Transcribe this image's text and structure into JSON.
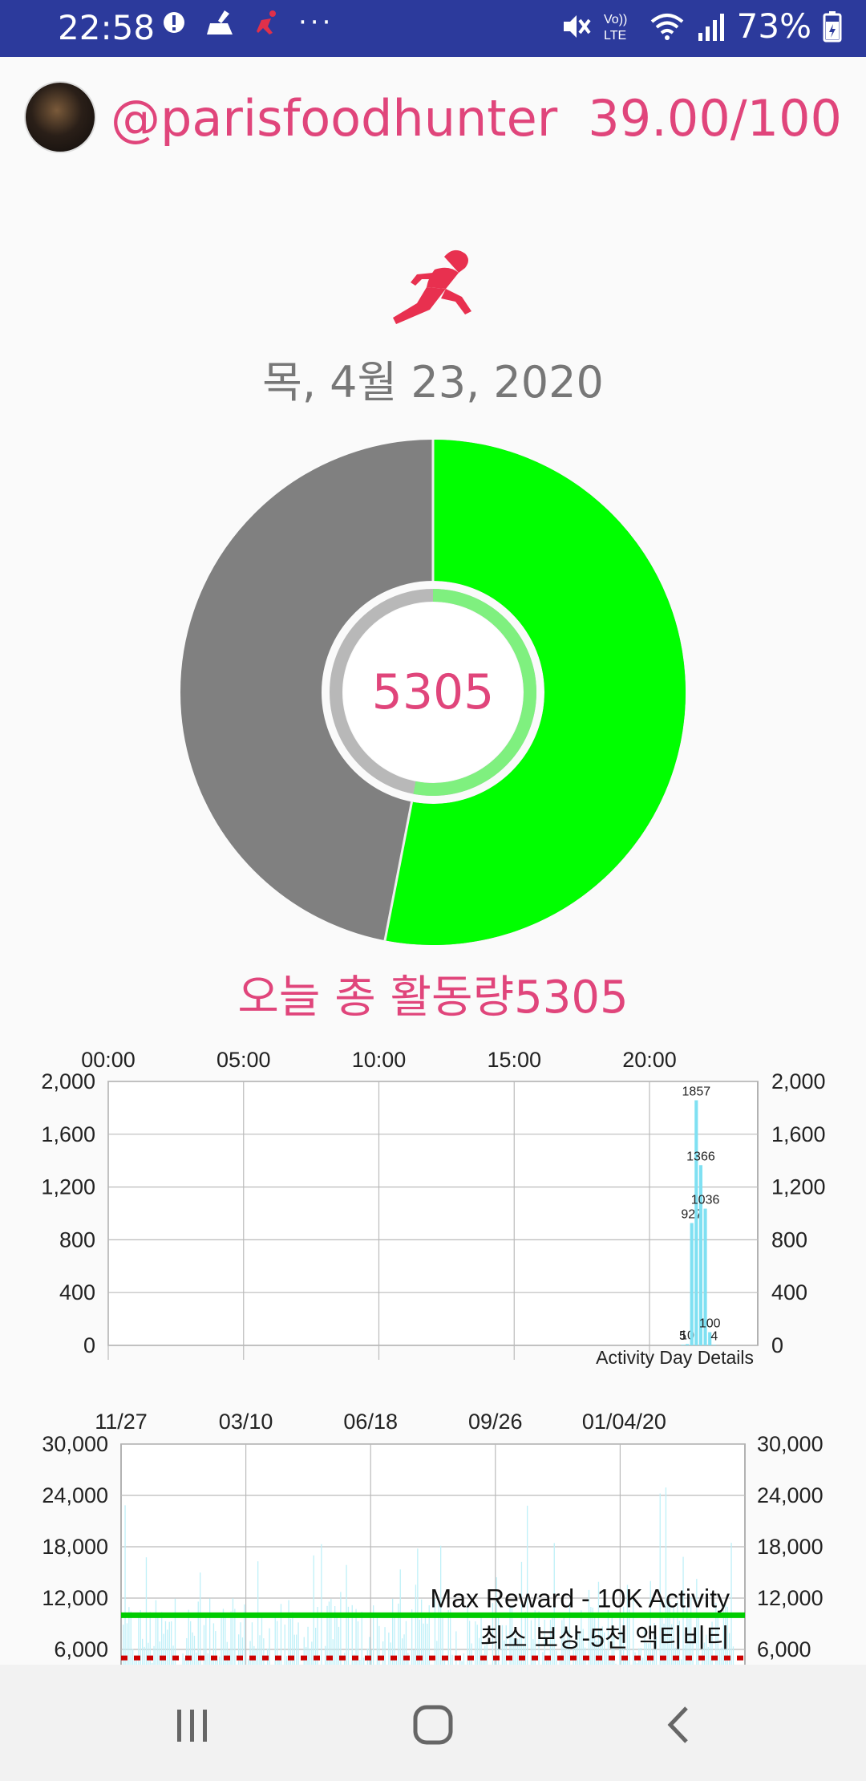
{
  "status_bar": {
    "time": "22:58",
    "battery": "73%",
    "icons_left": [
      "notification-icon",
      "cleaner-icon",
      "runner-small-icon",
      "more-icon"
    ],
    "icons_right": [
      "mute-icon",
      "volte-icon",
      "wifi-icon",
      "signal-icon",
      "battery-icon"
    ]
  },
  "header": {
    "username": "@parisfoodhunter",
    "score": "39.00/100"
  },
  "date": "목, 4월 23, 2020",
  "donut": {
    "value": "5305",
    "progress": 0.5305,
    "filled_color": "#00ff00",
    "remaining_color": "#808080",
    "inner_ring_color": "#b8b8b8"
  },
  "total_label": "오늘 총 활동량5305",
  "chart_data": [
    {
      "type": "bar",
      "title": "",
      "caption": "Activity Day Details",
      "x_tick_labels": [
        "00:00",
        "05:00",
        "10:00",
        "15:00",
        "20:00"
      ],
      "y_tick_labels": [
        "2,000",
        "1,600",
        "1,200",
        "800",
        "400",
        "0"
      ],
      "ylim": [
        0,
        2000
      ],
      "bar_color": "#7fe0f2",
      "bars": [
        {
          "x": "21:10",
          "value": 5,
          "label": "5"
        },
        {
          "x": "21:20",
          "value": 10,
          "label": "10"
        },
        {
          "x": "21:30",
          "value": 927,
          "label": "927"
        },
        {
          "x": "21:40",
          "value": 1857,
          "label": "1857"
        },
        {
          "x": "21:50",
          "value": 1366,
          "label": "1366"
        },
        {
          "x": "22:00",
          "value": 1036,
          "label": "1036"
        },
        {
          "x": "22:10",
          "value": 100,
          "label": "100"
        },
        {
          "x": "22:20",
          "value": 4,
          "label": "4"
        }
      ]
    },
    {
      "type": "bar",
      "title": "",
      "x_tick_labels": [
        "11/27",
        "03/10",
        "06/18",
        "09/26",
        "01/04/20"
      ],
      "y_tick_labels": [
        "30,000",
        "24,000",
        "18,000",
        "12,000",
        "6,000"
      ],
      "ylim": [
        4000,
        30000
      ],
      "bar_color": "#bff0f8",
      "reference_lines": [
        {
          "label": "Max Reward - 10K Activity",
          "value": 10000,
          "color": "#00cc00",
          "style": "solid"
        },
        {
          "label": "최소 보상-5천 액티비티",
          "value": 5000,
          "color": "#cc0000",
          "style": "dashed"
        }
      ]
    }
  ]
}
